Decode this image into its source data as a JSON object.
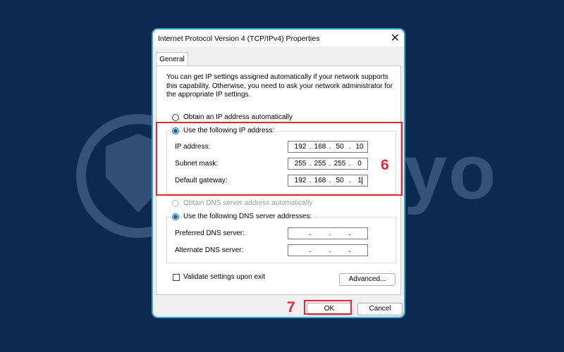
{
  "watermark": {
    "text": "Safelyo",
    "logo": "shield-lock-logo"
  },
  "dialog": {
    "title": "Internet Protocol Version 4 (TCP/IPv4) Properties",
    "close_icon": "close-icon",
    "tab": "General",
    "description": "You can get IP settings assigned automatically if your network supports this capability. Otherwise, you need to ask your network administrator for the appropriate IP settings.",
    "ip_mode": {
      "auto_label": "Obtain an IP address automatically",
      "manual_label": "Use the following IP address:",
      "selected": "manual"
    },
    "ip_fields": [
      {
        "label": "IP address:",
        "octets": [
          "192",
          "168",
          "50",
          "10"
        ]
      },
      {
        "label": "Subnet mask:",
        "octets": [
          "255",
          "255",
          "255",
          "0"
        ]
      },
      {
        "label": "Default gateway:",
        "octets": [
          "192",
          "168",
          "50",
          "1"
        ]
      }
    ],
    "dns_mode": {
      "auto_label": "Obtain DNS server address automatically",
      "manual_label": "Use the following DNS server addresses:",
      "selected": "manual"
    },
    "dns_fields": [
      {
        "label": "Preferred DNS server:",
        "octets": [
          "",
          "",
          "",
          ""
        ]
      },
      {
        "label": "Alternate DNS server:",
        "octets": [
          "",
          "",
          "",
          ""
        ]
      }
    ],
    "validate_label": "Validate settings upon exit",
    "validate_checked": false,
    "advanced_button": "Advanced...",
    "ok_button": "OK",
    "cancel_button": "Cancel"
  },
  "annotations": {
    "ip_box_step": "6",
    "ok_step": "7",
    "highlight_color": "#e4283a"
  }
}
